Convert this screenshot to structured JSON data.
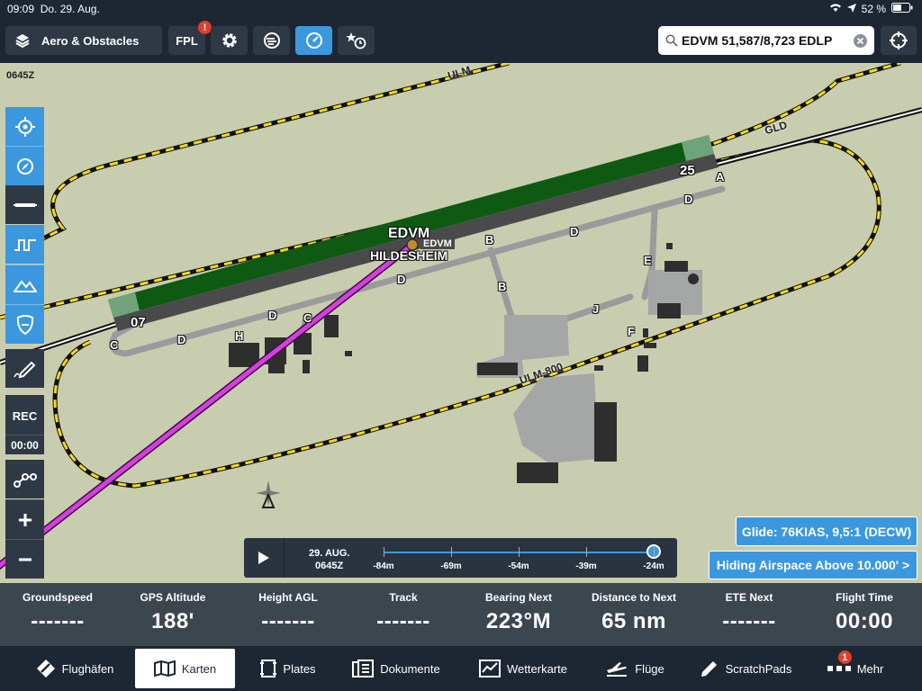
{
  "status_bar": {
    "time": "09:09",
    "date": "Do. 29. Aug.",
    "battery": "52 %"
  },
  "toolbar": {
    "layers_label": "Aero & Obstacles",
    "fpl_label": "FPL",
    "fpl_badge": "!",
    "search_value": "EDVM 51,587/8,723 EDLP"
  },
  "map": {
    "timestamp": "0645Z",
    "airport_code": "EDVM",
    "airport_name": "HILDESHEIM",
    "airport_marker_label": "EDVM",
    "runway_ends": [
      "07",
      "25"
    ],
    "taxiway_labels": [
      "A",
      "B",
      "B",
      "C",
      "C",
      "D",
      "D",
      "D",
      "D",
      "D",
      "E",
      "F",
      "H",
      "J"
    ],
    "airspace_labels": [
      "ULM",
      "GLD",
      "ULM-800"
    ]
  },
  "left_tools": {
    "rec_label": "REC",
    "rec_time": "00:00"
  },
  "info_buttons": {
    "glide": "Glide: 76KIAS, 9,5:1 (DECW)",
    "airspace": "Hiding Airspace Above 10.000' >"
  },
  "timeline": {
    "date": "29. AUG.",
    "time": "0645Z",
    "ticks": [
      "-84m",
      "-69m",
      "-54m",
      "-39m",
      "-24m"
    ],
    "position_fraction": 1.0
  },
  "instruments": [
    {
      "label": "Groundspeed",
      "value": "-------"
    },
    {
      "label": "GPS Altitude",
      "value": "188'"
    },
    {
      "label": "Height AGL",
      "value": "-------"
    },
    {
      "label": "Track",
      "value": "-------"
    },
    {
      "label": "Bearing Next",
      "value": "223°M"
    },
    {
      "label": "Distance to Next",
      "value": "65 nm"
    },
    {
      "label": "ETE Next",
      "value": "-------"
    },
    {
      "label": "Flight Time",
      "value": "00:00"
    }
  ],
  "tabs": [
    {
      "label": "Flughäfen",
      "icon": "airport-icon"
    },
    {
      "label": "Karten",
      "icon": "map-icon"
    },
    {
      "label": "Plates",
      "icon": "plates-icon"
    },
    {
      "label": "Dokumente",
      "icon": "documents-icon"
    },
    {
      "label": "Wetterkarte",
      "icon": "weather-map-icon"
    },
    {
      "label": "Flüge",
      "icon": "flights-icon"
    },
    {
      "label": "ScratchPads",
      "icon": "pencil-icon"
    },
    {
      "label": "Mehr",
      "icon": "more-icon",
      "badge": "1"
    }
  ],
  "active_tab": "Karten",
  "colors": {
    "accent": "#3b98de",
    "toolbar": "#1d2633",
    "map_bg": "#c9cdb0",
    "runway_green": "#0f5a13",
    "route_magenta": "#d63ee0",
    "airspace_yellow": "#f3dc1e",
    "badge_red": "#e53b2c"
  }
}
